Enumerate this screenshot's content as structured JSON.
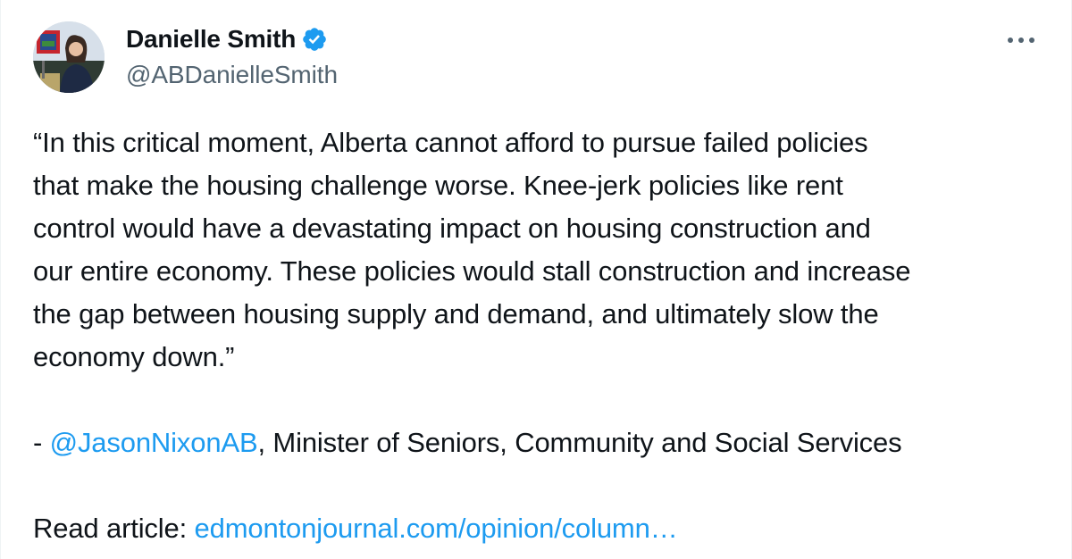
{
  "author": {
    "display_name": "Danielle Smith",
    "handle": "@ABDanielleSmith",
    "verified": true
  },
  "quote_lines": [
    "“In this critical moment, Alberta cannot afford to pursue failed policies",
    "that make the housing challenge worse. Knee-jerk policies like rent",
    "control would have a devastating impact on housing construction and",
    "our entire economy. These policies would stall construction and increase",
    "the gap between housing supply and demand, and ultimately slow the",
    "economy down.”"
  ],
  "attribution": {
    "prefix": "- ",
    "mention": "@JasonNixonAB",
    "suffix": ", Minister of Seniors, Community and Social Services"
  },
  "article": {
    "label": "Read article: ",
    "link_text": "edmontonjournal.com/opinion/column…"
  },
  "icons": {
    "verified": "verified-badge-icon",
    "more": "more-horizontal-icon"
  },
  "colors": {
    "link": "#1d9bf0",
    "secondary_text": "#536471",
    "primary_text": "#0f1419"
  }
}
